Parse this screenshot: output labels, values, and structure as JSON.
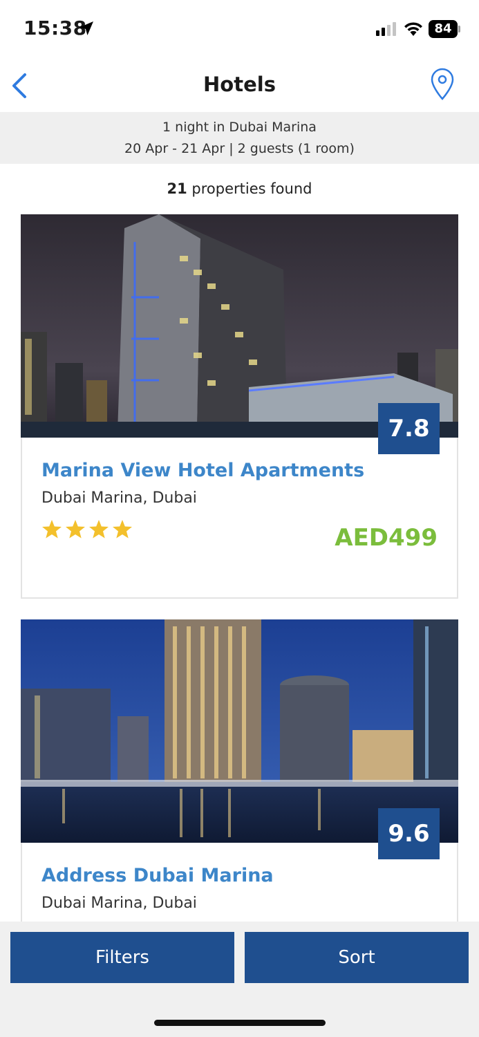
{
  "status": {
    "time": "15:38",
    "battery": "84"
  },
  "nav": {
    "title": "Hotels",
    "back_icon": "chevron-left-icon",
    "map_icon": "map-pin-icon"
  },
  "search_summary": {
    "line1": "1 night in Dubai Marina",
    "line2": "20 Apr - 21 Apr | 2 guests (1 room)"
  },
  "results": {
    "count": "21",
    "count_suffix": " properties found"
  },
  "hotels": [
    {
      "name": "Marina View Hotel Apartments",
      "location": "Dubai Marina, Dubai",
      "score": "7.8",
      "stars": 4,
      "price": "AED499"
    },
    {
      "name": "Address Dubai Marina",
      "location": "Dubai Marina, Dubai",
      "score": "9.6"
    }
  ],
  "actions": {
    "filters_label": "Filters",
    "sort_label": "Sort"
  },
  "colors": {
    "primary": "#1f4f8f",
    "link": "#3d86c9",
    "price": "#7bbd3c",
    "star": "#f3c02c"
  }
}
